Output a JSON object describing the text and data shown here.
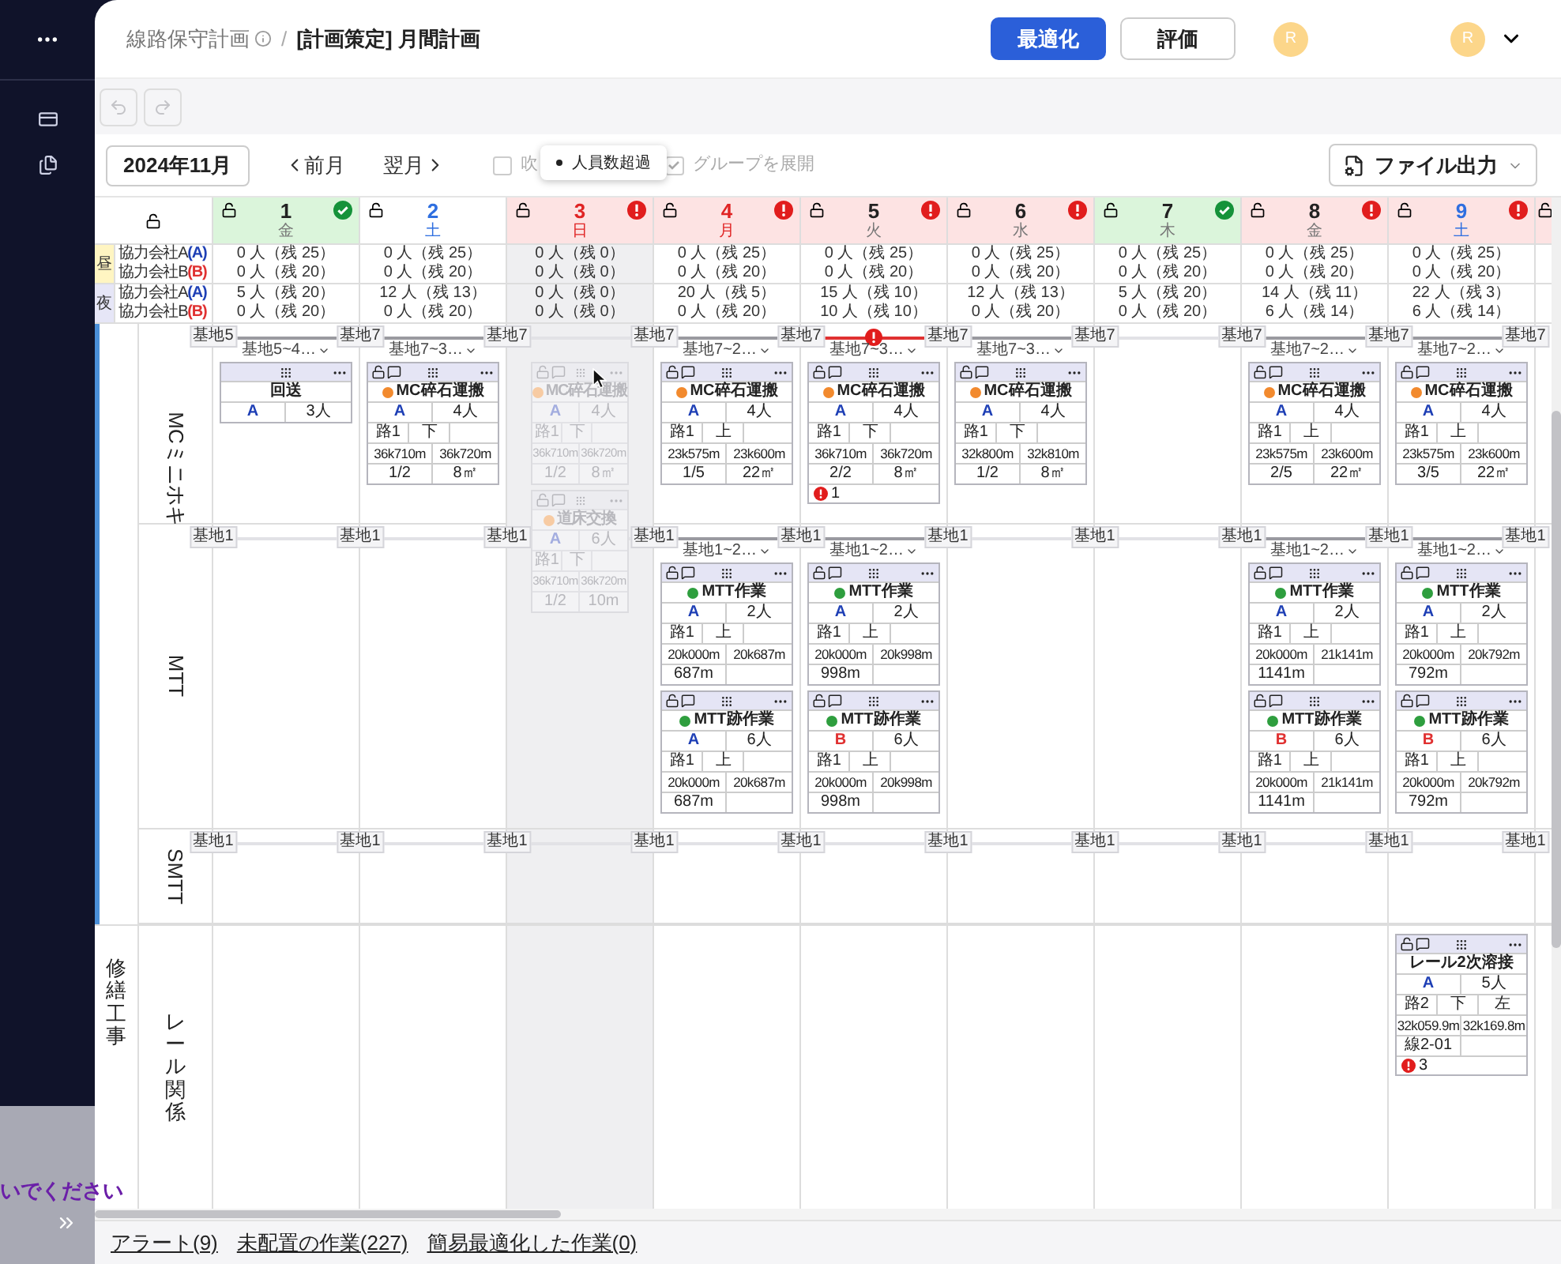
{
  "sidebar": {
    "overlay_text": "いでください"
  },
  "header": {
    "breadcrumb": {
      "parent": "線路保守計画",
      "separator": "/",
      "current": "[計画策定] 月間計画"
    },
    "buttons": [
      {
        "label": "最適化",
        "kind": "primary"
      },
      {
        "label": "評価",
        "kind": "secondary"
      }
    ],
    "avatars": [
      {
        "initial": "R"
      },
      {
        "initial": "R",
        "menu": true
      }
    ]
  },
  "history_buttons": [
    {
      "kind": "undo",
      "disabled": true
    },
    {
      "kind": "redo",
      "disabled": true
    }
  ],
  "controls": {
    "month": "2024年11月",
    "prev": "前月",
    "next": "翌月",
    "options": [
      {
        "label": "吹",
        "checked": false,
        "disabled": true
      },
      {
        "label": "グループを展開",
        "checked": true,
        "disabled": true
      }
    ],
    "tooltip": "人員数超過",
    "export": "ファイル出力"
  },
  "days": [
    {
      "day": "1",
      "weekday": "金",
      "ok": true,
      "alert": false,
      "saturday": false,
      "holiday": false,
      "shaded": false
    },
    {
      "day": "2",
      "weekday": "土",
      "ok": false,
      "alert": false,
      "saturday": true,
      "holiday": false,
      "shaded": false
    },
    {
      "day": "3",
      "weekday": "日",
      "ok": false,
      "alert": true,
      "saturday": false,
      "holiday": true,
      "shaded": true
    },
    {
      "day": "4",
      "weekday": "月",
      "ok": false,
      "alert": true,
      "saturday": false,
      "holiday": true,
      "shaded": false
    },
    {
      "day": "5",
      "weekday": "火",
      "ok": false,
      "alert": true,
      "saturday": false,
      "holiday": false,
      "shaded": false
    },
    {
      "day": "6",
      "weekday": "水",
      "ok": false,
      "alert": true,
      "saturday": false,
      "holiday": false,
      "shaded": false
    },
    {
      "day": "7",
      "weekday": "木",
      "ok": true,
      "alert": false,
      "saturday": false,
      "holiday": false,
      "shaded": false
    },
    {
      "day": "8",
      "weekday": "金",
      "ok": false,
      "alert": true,
      "saturday": false,
      "holiday": false,
      "shaded": false
    },
    {
      "day": "9",
      "weekday": "土",
      "ok": false,
      "alert": true,
      "saturday": true,
      "holiday": false,
      "shaded": false
    }
  ],
  "next_day_column": {
    "alert": true
  },
  "staffing": [
    {
      "label": "昼",
      "color": "#fff5c2",
      "rows": [
        {
          "name": "協力会社A",
          "code": "(A)",
          "color": "#1e3fb5",
          "values": [
            "0 人（残 25）",
            "0 人（残 25）",
            "0 人（残 0）",
            "0 人（残 25）",
            "0 人（残 25）",
            "0 人（残 25）",
            "0 人（残 25）",
            "0 人（残 25）",
            "0 人（残 25）"
          ]
        },
        {
          "name": "協力会社B",
          "code": "(B)",
          "color": "#e03131",
          "values": [
            "0 人（残 20）",
            "0 人（残 20）",
            "0 人（残 0）",
            "0 人（残 20）",
            "0 人（残 20）",
            "0 人（残 20）",
            "0 人（残 20）",
            "0 人（残 20）",
            "0 人（残 20）"
          ]
        }
      ]
    },
    {
      "label": "夜",
      "color": "#e6e6f7",
      "rows": [
        {
          "name": "協力会社A",
          "code": "(A)",
          "color": "#1e3fb5",
          "values": [
            "5 人（残 20）",
            "12 人（残 13）",
            "0 人（残 0）",
            "20 人（残 5）",
            "15 人（残 10）",
            "12 人（残 13）",
            "5 人（残 20）",
            "14 人（残 11）",
            "22 人（残 3）"
          ]
        },
        {
          "name": "協力会社B",
          "code": "(B)",
          "color": "#e03131",
          "values": [
            "0 人（残 20）",
            "0 人（残 20）",
            "0 人（残 0）",
            "0 人（残 20）",
            "10 人（残 10）",
            "0 人（残 20）",
            "0 人（残 20）",
            "6 人（残 14）",
            "6 人（残 14）"
          ]
        }
      ]
    }
  ],
  "groups": [
    {
      "color": "#4a8fd8",
      "rows": [
        {
          "label": "MCミニホキ",
          "rotated": true,
          "bases": [
            "基地5",
            "基地7",
            "基地7",
            "基地7",
            "基地7",
            "基地7",
            "基地7",
            "基地7",
            "基地7",
            "基地7"
          ],
          "routes": [
            {
              "active": true,
              "label": "基地5~4…",
              "alert": false
            },
            {
              "active": true,
              "label": "基地7~3…",
              "alert": false
            },
            {
              "active": false
            },
            {
              "active": true,
              "label": "基地7~2…",
              "alert": false
            },
            {
              "active": true,
              "label": "基地7~3…",
              "alert": true
            },
            {
              "active": true,
              "label": "基地7~3…",
              "alert": false
            },
            {
              "active": false
            },
            {
              "active": true,
              "label": "基地7~2…",
              "alert": false
            },
            {
              "active": true,
              "label": "基地7~2…",
              "alert": false
            }
          ],
          "cells": [
            [
              {
                "kind": "transfer",
                "title": "回送",
                "crew": {
                  "code": "A",
                  "color": "#1e3fb5"
                },
                "people": "3人"
              }
            ],
            [
              {
                "kind": "work",
                "title": "MC碎石運搬",
                "color": "#f28a2e",
                "crew": {
                  "code": "A",
                  "color": "#1e3fb5"
                },
                "people": "4人",
                "track": [
                  "路1",
                  "下"
                ],
                "km": [
                  "36k710m",
                  "36k720m"
                ],
                "extra": [
                  "1/2",
                  "8㎡"
                ]
              }
            ],
            [
              {
                "kind": "work",
                "dragging": true,
                "pointer": true,
                "title": "MC碎石運搬",
                "color": "#f7cba3",
                "crew": {
                  "code": "A",
                  "color": "#a3addf"
                },
                "people": "4人",
                "track": [
                  "路1",
                  "下"
                ],
                "km": [
                  "36k710m",
                  "36k720m"
                ],
                "extra": [
                  "1/2",
                  "8㎡"
                ]
              },
              {
                "kind": "work",
                "dragging": true,
                "pointer": false,
                "title": "道床交換",
                "color": "#f7cba3",
                "crew": {
                  "code": "A",
                  "color": "#a3addf"
                },
                "people": "6人",
                "track": [
                  "路1",
                  "下"
                ],
                "km": [
                  "36k710m",
                  "36k720m"
                ],
                "extra": [
                  "1/2",
                  "10m"
                ]
              }
            ],
            [
              {
                "kind": "work",
                "title": "MC碎石運搬",
                "color": "#f28a2e",
                "crew": {
                  "code": "A",
                  "color": "#1e3fb5"
                },
                "people": "4人",
                "track": [
                  "路1",
                  "上"
                ],
                "km": [
                  "23k575m",
                  "23k600m"
                ],
                "extra": [
                  "1/5",
                  "22㎡"
                ]
              }
            ],
            [
              {
                "kind": "work",
                "title": "MC碎石運搬",
                "color": "#f28a2e",
                "crew": {
                  "code": "A",
                  "color": "#1e3fb5"
                },
                "people": "4人",
                "track": [
                  "路1",
                  "下"
                ],
                "km": [
                  "36k710m",
                  "36k720m"
                ],
                "extra": [
                  "2/2",
                  "8㎡"
                ],
                "alerts": "1"
              }
            ],
            [
              {
                "kind": "work",
                "title": "MC碎石運搬",
                "color": "#f28a2e",
                "crew": {
                  "code": "A",
                  "color": "#1e3fb5"
                },
                "people": "4人",
                "track": [
                  "路1",
                  "下"
                ],
                "km": [
                  "32k800m",
                  "32k810m"
                ],
                "extra": [
                  "1/2",
                  "8㎡"
                ]
              }
            ],
            [],
            [
              {
                "kind": "work",
                "title": "MC碎石運搬",
                "color": "#f28a2e",
                "crew": {
                  "code": "A",
                  "color": "#1e3fb5"
                },
                "people": "4人",
                "track": [
                  "路1",
                  "上"
                ],
                "km": [
                  "23k575m",
                  "23k600m"
                ],
                "extra": [
                  "2/5",
                  "22㎡"
                ]
              }
            ],
            [
              {
                "kind": "work",
                "title": "MC碎石運搬",
                "color": "#f28a2e",
                "crew": {
                  "code": "A",
                  "color": "#1e3fb5"
                },
                "people": "4人",
                "track": [
                  "路1",
                  "上"
                ],
                "km": [
                  "23k575m",
                  "23k600m"
                ],
                "extra": [
                  "3/5",
                  "22㎡"
                ]
              }
            ]
          ]
        },
        {
          "label": "MTT",
          "rotated": true,
          "bases": [
            "基地1",
            "基地1",
            "基地1",
            "基地1",
            "基地1",
            "基地1",
            "基地1",
            "基地1",
            "基地1",
            "基地1"
          ],
          "routes": [
            {
              "active": false
            },
            {
              "active": false
            },
            {
              "active": false
            },
            {
              "active": true,
              "label": "基地1~2…",
              "alert": false
            },
            {
              "active": true,
              "label": "基地1~2…",
              "alert": false
            },
            {
              "active": false
            },
            {
              "active": false
            },
            {
              "active": true,
              "label": "基地1~2…",
              "alert": false
            },
            {
              "active": true,
              "label": "基地1~2…",
              "alert": false
            }
          ],
          "cells": [
            [],
            [],
            [],
            [
              {
                "kind": "work",
                "title": "MTT作業",
                "color": "#2e9e3e",
                "crew": {
                  "code": "A",
                  "color": "#1e3fb5"
                },
                "people": "2人",
                "track": [
                  "路1",
                  "上"
                ],
                "km": [
                  "20k000m",
                  "20k687m"
                ],
                "extra": [
                  "687m"
                ]
              },
              {
                "kind": "work",
                "title": "MTT跡作業",
                "color": "#2e9e3e",
                "crew": {
                  "code": "A",
                  "color": "#1e3fb5"
                },
                "people": "6人",
                "track": [
                  "路1",
                  "上"
                ],
                "km": [
                  "20k000m",
                  "20k687m"
                ],
                "extra": [
                  "687m"
                ]
              }
            ],
            [
              {
                "kind": "work",
                "title": "MTT作業",
                "color": "#2e9e3e",
                "crew": {
                  "code": "A",
                  "color": "#1e3fb5"
                },
                "people": "2人",
                "track": [
                  "路1",
                  "上"
                ],
                "km": [
                  "20k000m",
                  "20k998m"
                ],
                "extra": [
                  "998m"
                ]
              },
              {
                "kind": "work",
                "title": "MTT跡作業",
                "color": "#2e9e3e",
                "crew": {
                  "code": "B",
                  "color": "#e03131"
                },
                "people": "6人",
                "track": [
                  "路1",
                  "上"
                ],
                "km": [
                  "20k000m",
                  "20k998m"
                ],
                "extra": [
                  "998m"
                ]
              }
            ],
            [],
            [],
            [
              {
                "kind": "work",
                "title": "MTT作業",
                "color": "#2e9e3e",
                "crew": {
                  "code": "A",
                  "color": "#1e3fb5"
                },
                "people": "2人",
                "track": [
                  "路1",
                  "上"
                ],
                "km": [
                  "20k000m",
                  "21k141m"
                ],
                "extra": [
                  "1141m"
                ]
              },
              {
                "kind": "work",
                "title": "MTT跡作業",
                "color": "#2e9e3e",
                "crew": {
                  "code": "B",
                  "color": "#e03131"
                },
                "people": "6人",
                "track": [
                  "路1",
                  "上"
                ],
                "km": [
                  "20k000m",
                  "21k141m"
                ],
                "extra": [
                  "1141m"
                ]
              }
            ],
            [
              {
                "kind": "work",
                "title": "MTT作業",
                "color": "#2e9e3e",
                "crew": {
                  "code": "A",
                  "color": "#1e3fb5"
                },
                "people": "2人",
                "track": [
                  "路1",
                  "上"
                ],
                "km": [
                  "20k000m",
                  "20k792m"
                ],
                "extra": [
                  "792m"
                ]
              },
              {
                "kind": "work",
                "title": "MTT跡作業",
                "color": "#2e9e3e",
                "crew": {
                  "code": "B",
                  "color": "#e03131"
                },
                "people": "6人",
                "track": [
                  "路1",
                  "上"
                ],
                "km": [
                  "20k000m",
                  "20k792m"
                ],
                "extra": [
                  "792m"
                ]
              }
            ]
          ]
        },
        {
          "label": "SMTT",
          "rotated": true,
          "bases": [
            "基地1",
            "基地1",
            "基地1",
            "基地1",
            "基地1",
            "基地1",
            "基地1",
            "基地1",
            "基地1",
            "基地1"
          ]
        }
      ]
    },
    {
      "label": "修繕工事",
      "rows": [
        {
          "label": "レール関係",
          "rotated": false,
          "cells": [
            [],
            [],
            [],
            [],
            [],
            [],
            [],
            [],
            [
              {
                "kind": "work",
                "title": "レール2次溶接",
                "crew": {
                  "code": "A",
                  "color": "#1e3fb5"
                },
                "people": "5人",
                "track": [
                  "路2",
                  "下",
                  "左"
                ],
                "km": [
                  "32k059.9m",
                  "32k169.8m"
                ],
                "extra": [
                  "線2-01"
                ],
                "alerts": "3"
              }
            ]
          ]
        }
      ]
    }
  ],
  "footer_links": [
    "アラート(9)",
    "未配置の作業(227)",
    "簡易最適化した作業(0)"
  ]
}
